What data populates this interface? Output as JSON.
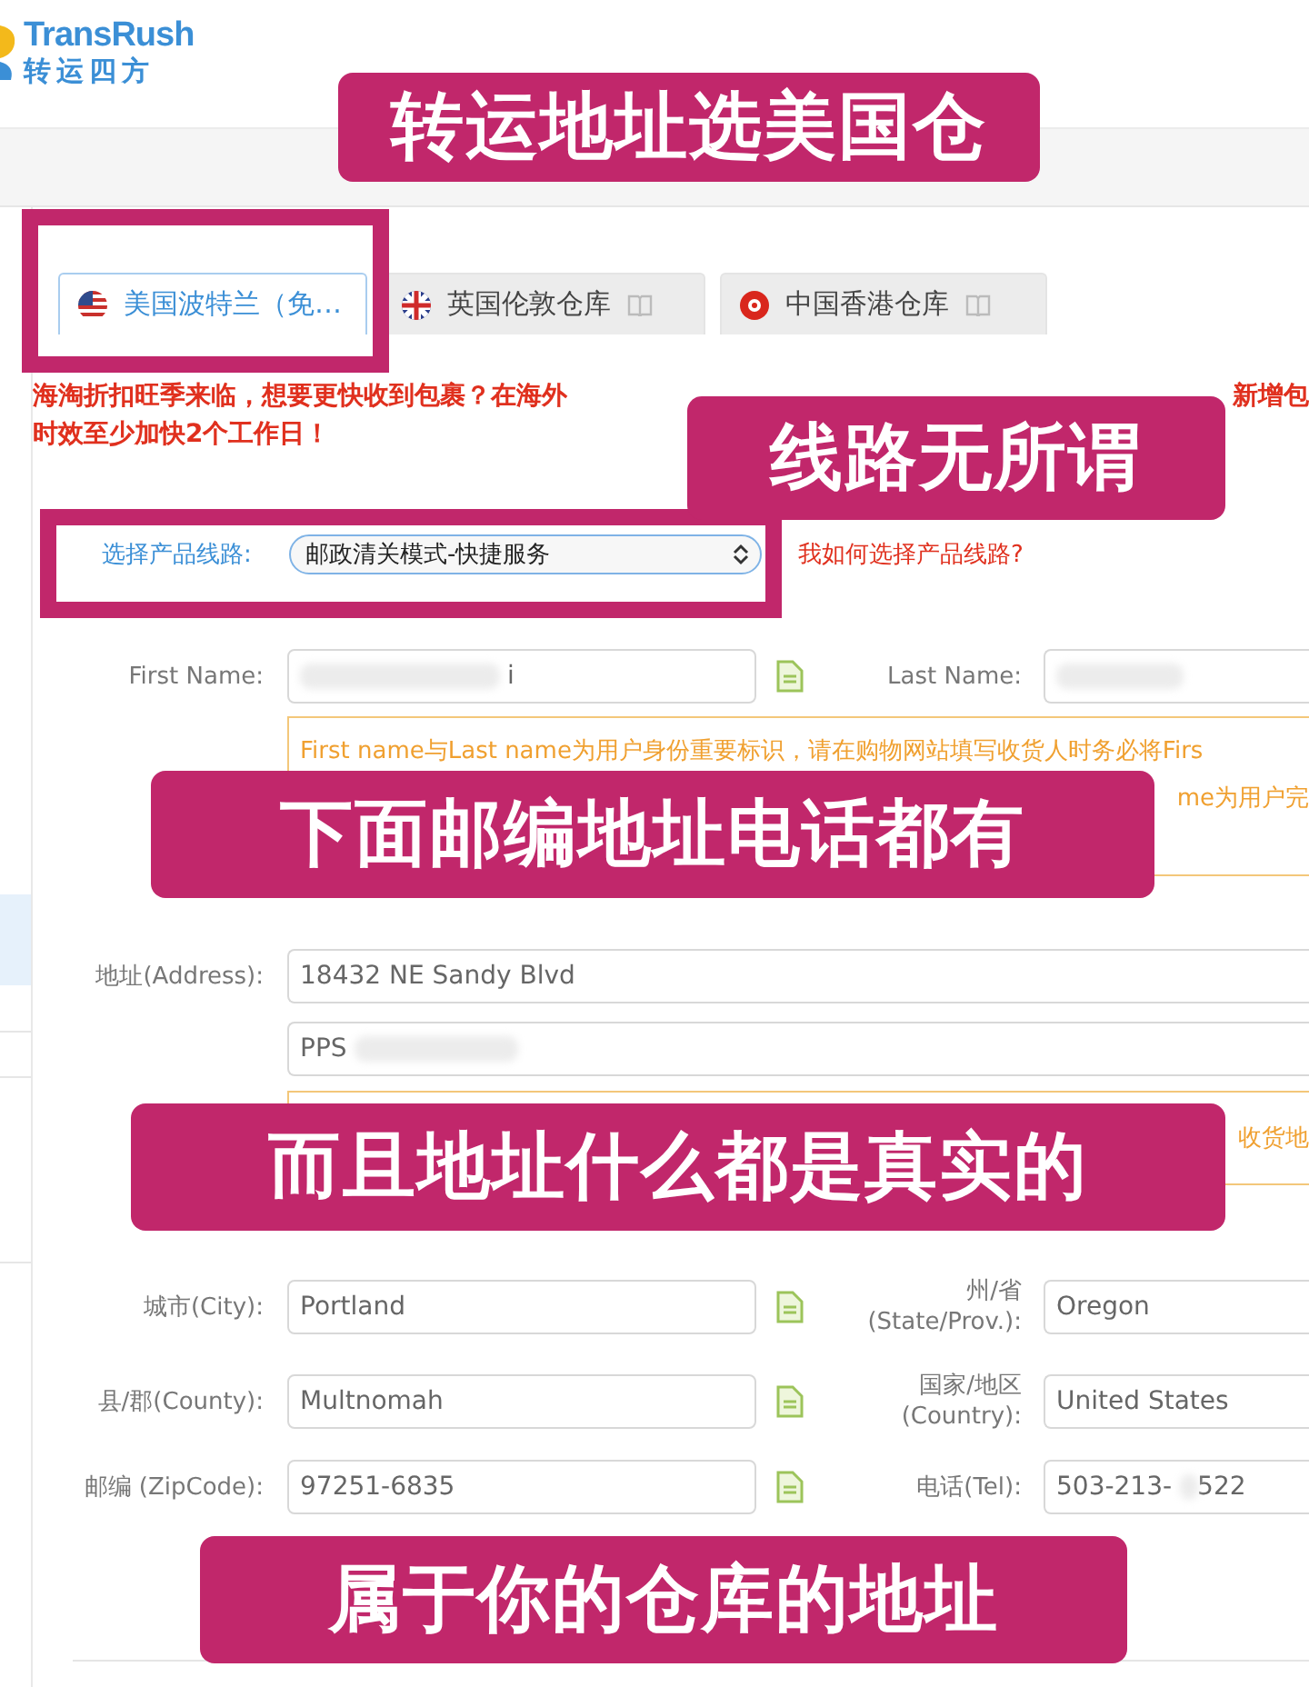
{
  "logo": {
    "name": "TransRush",
    "tagline": "转运四方"
  },
  "tabs": [
    {
      "label": "美国波特兰（免…",
      "kind": "us",
      "selected": true,
      "guide_icon": false
    },
    {
      "label": "英国伦敦仓库",
      "kind": "uk",
      "selected": false,
      "guide_icon": true
    },
    {
      "label": "中国香港仓库",
      "kind": "hk",
      "selected": false,
      "guide_icon": true
    }
  ],
  "notice": {
    "line_1_start": "海淘折扣旺季来临，想要更快收到包裹？在海外",
    "line_1_end": "新增包",
    "line_2": "时效至少加快2个工作日！"
  },
  "route": {
    "label": "选择产品线路:",
    "value": "邮政清关模式-快捷服务",
    "help_link": "我如何选择产品线路?"
  },
  "name_row": {
    "first_label": "First Name:",
    "first_value": "i",
    "last_label": "Last Name:"
  },
  "name_hint": {
    "line_1": "First name与Last name为用户身份重要标识，请在购物网站填写收货人时务必将Firs",
    "line_2_end": "me为用户完"
  },
  "address": {
    "label": "地址(Address):",
    "line_1": "18432 NE Sandy Blvd",
    "line_2": "PPS",
    "hint_end": "收货地"
  },
  "rows": [
    {
      "left_label": "城市(City):",
      "left_value": "Portland",
      "right_label": "州/省 (State/Prov.):",
      "right_value": "Oregon"
    },
    {
      "left_label": "县/郡(County):",
      "left_value": "Multnomah",
      "right_label": "国家/地区 (Country):",
      "right_value": "United States"
    },
    {
      "left_label": "邮编 (ZipCode):",
      "left_value": "97251-6835",
      "right_label": "电话(Tel):",
      "right_value": "503-213-",
      "right_value_end": "522"
    }
  ],
  "annotations": [
    {
      "text": "转运地址选美国仓"
    },
    {
      "text": "线路无所谓"
    },
    {
      "text": "下面邮编地址电话都有"
    },
    {
      "text": "而且地址什么都是真实的"
    },
    {
      "text": "属于你的仓库的地址"
    }
  ]
}
